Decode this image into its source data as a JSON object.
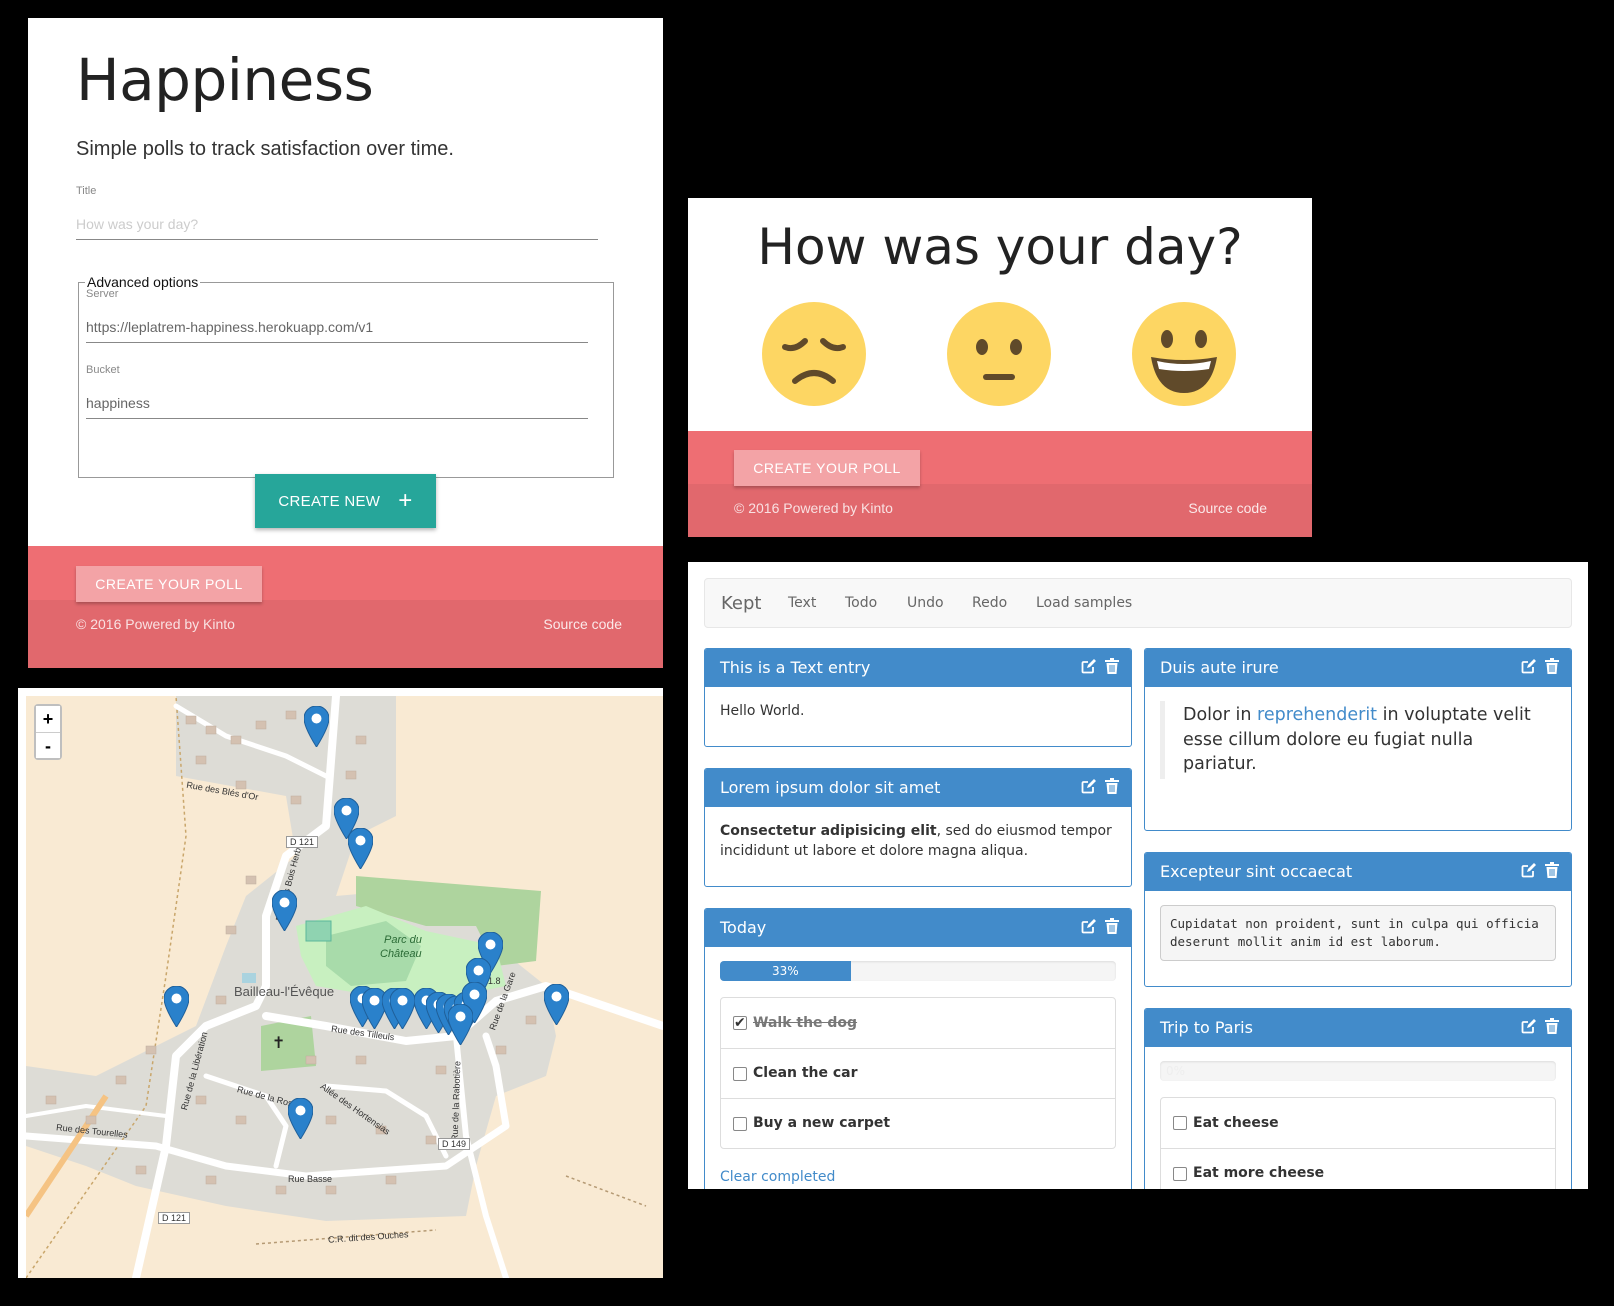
{
  "form_panel": {
    "title": "Happiness",
    "subtitle": "Simple polls to track satisfaction over time.",
    "title_field": {
      "label": "Title",
      "placeholder": "How was your day?",
      "value": ""
    },
    "advanced": {
      "legend": "Advanced options",
      "server": {
        "label": "Server",
        "value": "https://leplatrem-happiness.herokuapp.com/v1"
      },
      "bucket": {
        "label": "Bucket",
        "value": "happiness"
      }
    },
    "create_new_label": "CREATE NEW",
    "create_new_icon": "plus-icon",
    "footer": {
      "create_poll_label": "CREATE YOUR POLL",
      "copyright": "© 2016 Powered by Kinto",
      "source_link": "Source code"
    }
  },
  "day_panel": {
    "question": "How was your day?",
    "choices": [
      "sad-face-icon",
      "neutral-face-icon",
      "happy-face-icon"
    ],
    "footer": {
      "create_poll_label": "CREATE YOUR POLL",
      "copyright": "© 2016 Powered by Kinto",
      "source_link": "Source code"
    }
  },
  "map_panel": {
    "zoom_in": "+",
    "zoom_out": "-",
    "place_labels": {
      "village": "Bailleau-l'Évêque",
      "park": "Parc du",
      "park2": "Château",
      "road_bles": "Rue des Blés d'Or",
      "road_bois": "Rue des Bois Herbin",
      "road_tilleuls": "Rue des Tilleuls",
      "road_liberation": "Rue de la Libération",
      "road_roseraie": "Rue de la Roseraie",
      "road_hortensias": "Allée des Hortensias",
      "road_tourelles": "Rue des Tourelles",
      "road_basse": "Rue Basse",
      "road_rabotiere": "Rue de la Rabotière",
      "road_gare": "Rue de la Gare",
      "road_ouches": "C.R. dit des Ouches",
      "d121_top": "D 121",
      "d121_bottom": "D 121",
      "d149": "D 149",
      "elev": "121.8"
    },
    "accent": "#2a81cb"
  },
  "kept_panel": {
    "brand": "Kept",
    "nav": [
      "Text",
      "Todo",
      "Undo",
      "Redo",
      "Load samples"
    ],
    "cards": {
      "text_entry": {
        "title": "This is a Text entry",
        "body": "Hello World."
      },
      "lorem": {
        "title": "Lorem ipsum dolor sit amet",
        "bold": "Consectetur adipisicing elit",
        "rest": ", sed do eiusmod tempor incididunt ut labore et dolore magna aliqua."
      },
      "today": {
        "title": "Today",
        "progress": 33,
        "progress_label": "33%",
        "items": [
          {
            "text": "Walk the dog",
            "done": true
          },
          {
            "text": "Clean the car",
            "done": false
          },
          {
            "text": "Buy a new carpet",
            "done": false
          }
        ],
        "clear": "Clear completed"
      },
      "duis": {
        "title": "Duis aute irure",
        "q1": "Dolor in ",
        "link": "reprehenderit",
        "q2": " in voluptate velit esse cillum dolore eu fugiat nulla pariatur."
      },
      "excepteur": {
        "title": "Excepteur sint occaecat",
        "code": "Cupidatat non proident, sunt in culpa qui officia deserunt mollit anim id est laborum."
      },
      "paris": {
        "title": "Trip to Paris",
        "progress": 0,
        "progress_label": "0%",
        "items": [
          {
            "text": "Eat cheese",
            "done": false
          },
          {
            "text": "Eat more cheese",
            "done": false
          }
        ]
      }
    },
    "accent": "#428bca"
  }
}
